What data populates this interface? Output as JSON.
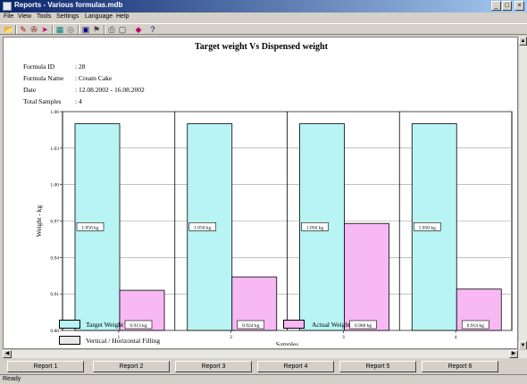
{
  "window": {
    "title": "Reports  -  Various formulas.mdb",
    "controls": [
      "_",
      "□",
      "×"
    ]
  },
  "menu": [
    "File",
    "View",
    "Tools",
    "Settings",
    "Language",
    "Help"
  ],
  "toolbar_icons": [
    {
      "name": "open-icon",
      "glyph": "📂",
      "color": "#b8860b"
    },
    {
      "name": "pen-icon",
      "glyph": "✎",
      "color": "#c00000"
    },
    {
      "name": "eraser-icon",
      "glyph": "✇",
      "color": "#800000"
    },
    {
      "name": "arrow-icon",
      "glyph": "➤",
      "color": "#c00060"
    },
    {
      "name": "chart-icon",
      "glyph": "▦",
      "color": "#008080"
    },
    {
      "name": "zoom-icon",
      "glyph": "◎",
      "color": "#606060"
    },
    {
      "name": "save-icon",
      "glyph": "▣",
      "color": "#000080"
    },
    {
      "name": "flag-icon",
      "glyph": "⚑",
      "color": "#404040"
    },
    {
      "name": "print-icon",
      "glyph": "⎙",
      "color": "#404040"
    },
    {
      "name": "preview-icon",
      "glyph": "▢",
      "color": "#404040"
    },
    {
      "name": "color-icon",
      "glyph": "◆",
      "color": "#c00060"
    },
    {
      "name": "help-icon",
      "glyph": "?",
      "color": "#000080"
    }
  ],
  "report": {
    "title": "Target weight Vs Dispensed weight",
    "info": [
      {
        "label": "Formula ID",
        "value": ": 28"
      },
      {
        "label": "Formula Name",
        "value": ": Cream Cake"
      },
      {
        "label": "Date",
        "value": ": 12.08.2002  -  16.08.2002"
      },
      {
        "label": "Total Samples",
        "value": ": 4"
      }
    ],
    "legend": [
      {
        "label": "Target Weight",
        "color": "#b8f4f4"
      },
      {
        "label": "Actual Weight",
        "color": "#f7b8f4"
      },
      {
        "label": "Vertical / Horizontal Filling",
        "color": "#e8e8e8"
      }
    ]
  },
  "chart_data": {
    "type": "bar",
    "categories": [
      "1",
      "2",
      "3",
      "4"
    ],
    "series": [
      {
        "name": "Target Weight",
        "values": [
          1.05,
          1.05,
          1.05,
          1.05
        ],
        "labels": [
          "1.050 kg",
          "1.050 kg",
          "1.050 kg",
          "1.050 kg"
        ],
        "color": "#b8f4f4"
      },
      {
        "name": "Actual Weight",
        "values": [
          0.913,
          0.924,
          0.968,
          0.914
        ],
        "labels": [
          "0.913 kg",
          "0.924 kg",
          "0.968 kg",
          "0.914 kg"
        ],
        "color": "#f7b8f4"
      }
    ],
    "xlabel": "Samples",
    "ylabel": "Weight - kg",
    "ylim": [
      0.88,
      1.06
    ],
    "yticks": [
      "0.88",
      "0.91",
      "0.94",
      "0.97",
      "1.00",
      "1.03",
      "1.06"
    ],
    "grid": true
  },
  "report_buttons": [
    "Report 1",
    "Report 2",
    "Report 3",
    "Report 4",
    "Report 5",
    "Report 6"
  ],
  "status": "Ready"
}
